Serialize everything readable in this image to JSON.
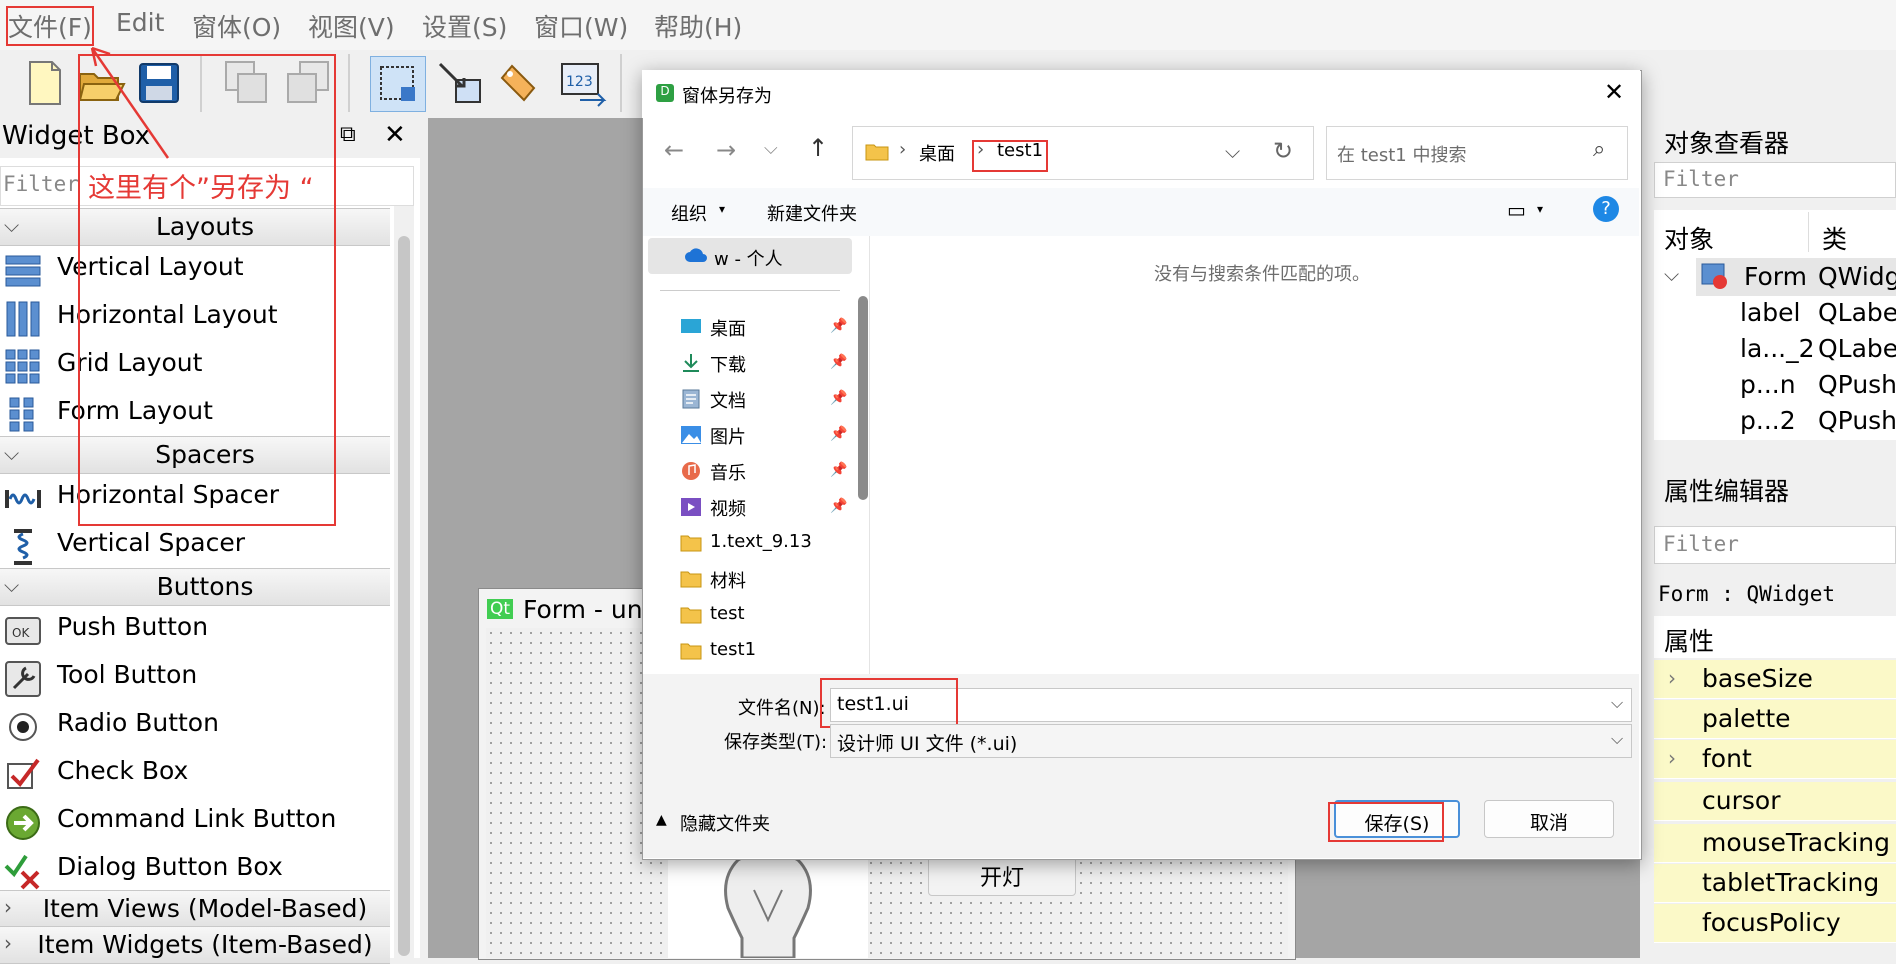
{
  "menubar": {
    "items": [
      "文件(F)",
      "Edit",
      "窗体(O)",
      "视图(V)",
      "设置(S)",
      "窗口(W)",
      "帮助(H)"
    ]
  },
  "widget_box": {
    "title": "Widget Box",
    "filter_placeholder": "Filter",
    "annotation": "这里有个”另存为 “",
    "categories": [
      "Layouts",
      "Spacers",
      "Buttons",
      "Item Views (Model-Based)",
      "Item Widgets (Item-Based)"
    ],
    "layouts": [
      "Vertical Layout",
      "Horizontal Layout",
      "Grid Layout",
      "Form Layout"
    ],
    "spacers": [
      "Horizontal Spacer",
      "Vertical Spacer"
    ],
    "buttons": [
      "Push Button",
      "Tool Button",
      "Radio Button",
      "Check Box",
      "Command Link Button",
      "Dialog Button Box"
    ]
  },
  "form_window": {
    "title": "Form - unt",
    "badge": "Qt",
    "button_label": "开灯"
  },
  "object_inspector": {
    "title": "对象查看器",
    "filter_placeholder": "Filter",
    "col_object": "对象",
    "col_class": "类",
    "rows": [
      {
        "obj": "Form",
        "cls": "QWidg"
      },
      {
        "obj": "label",
        "cls": "QLabel"
      },
      {
        "obj": "la..._2",
        "cls": "QLabel"
      },
      {
        "obj": "p...n",
        "cls": "QPushI"
      },
      {
        "obj": "p...2",
        "cls": "QPushI"
      }
    ]
  },
  "property_editor": {
    "title": "属性编辑器",
    "filter_placeholder": "Filter",
    "context": "Form : QWidget",
    "header": "属性",
    "props": [
      "baseSize",
      "palette",
      "font",
      "cursor",
      "mouseTracking",
      "tabletTracking",
      "focusPolicy"
    ]
  },
  "dialog": {
    "title": "窗体另存为",
    "app_badge": "D",
    "breadcrumb_root": "桌面",
    "breadcrumb_current": "test1",
    "search_placeholder": "在 test1 中搜索",
    "organize": "组织",
    "new_folder": "新建文件夹",
    "nav_account": "w - 个人",
    "nav_items": [
      "桌面",
      "下载",
      "文档",
      "图片",
      "音乐",
      "视频",
      "1.text_9.13",
      "材料",
      "test",
      "test1"
    ],
    "empty_message": "没有与搜索条件匹配的项。",
    "filename_label": "文件名(N):",
    "filename_value": "test1.ui",
    "filetype_label": "保存类型(T):",
    "filetype_value": "设计师 UI 文件 (*.ui)",
    "hide_folders": "隐藏文件夹",
    "save_button": "保存(S)",
    "cancel_button": "取消"
  },
  "colors": {
    "annotation_red": "#e53935",
    "property_highlight": "#fbf9c8",
    "help_blue": "#1e88e5"
  }
}
